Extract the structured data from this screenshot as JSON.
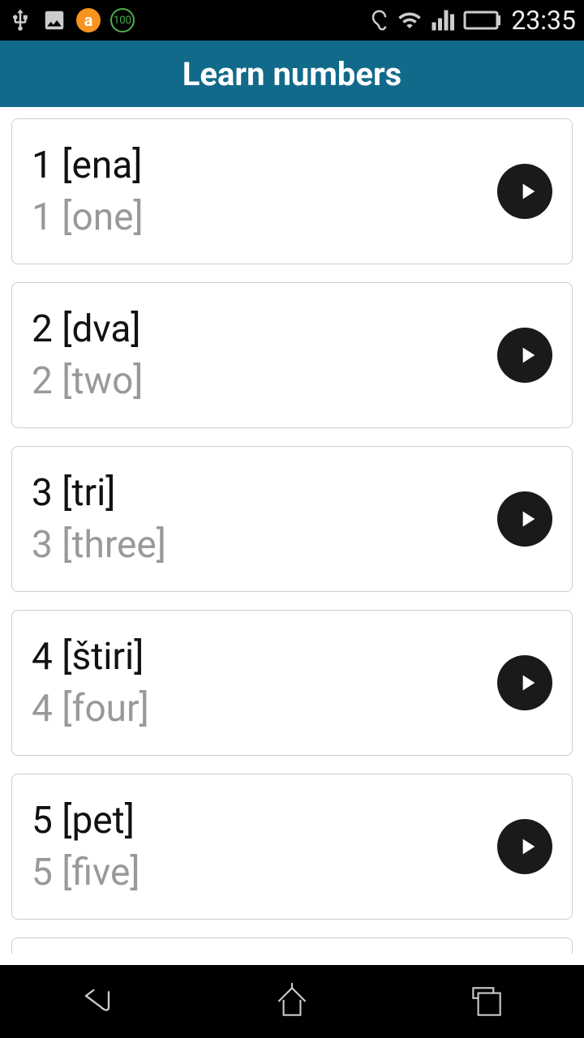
{
  "status": {
    "time": "23:35",
    "battery": "100",
    "green_badge": "100"
  },
  "header": {
    "title": "Learn numbers"
  },
  "numbers": [
    {
      "primary": "1 [ena]",
      "secondary": "1 [one]"
    },
    {
      "primary": "2 [dva]",
      "secondary": "2 [two]"
    },
    {
      "primary": "3 [tri]",
      "secondary": "3 [three]"
    },
    {
      "primary": "4 [štiri]",
      "secondary": "4 [four]"
    },
    {
      "primary": "5 [pet]",
      "secondary": "5 [five]"
    }
  ]
}
